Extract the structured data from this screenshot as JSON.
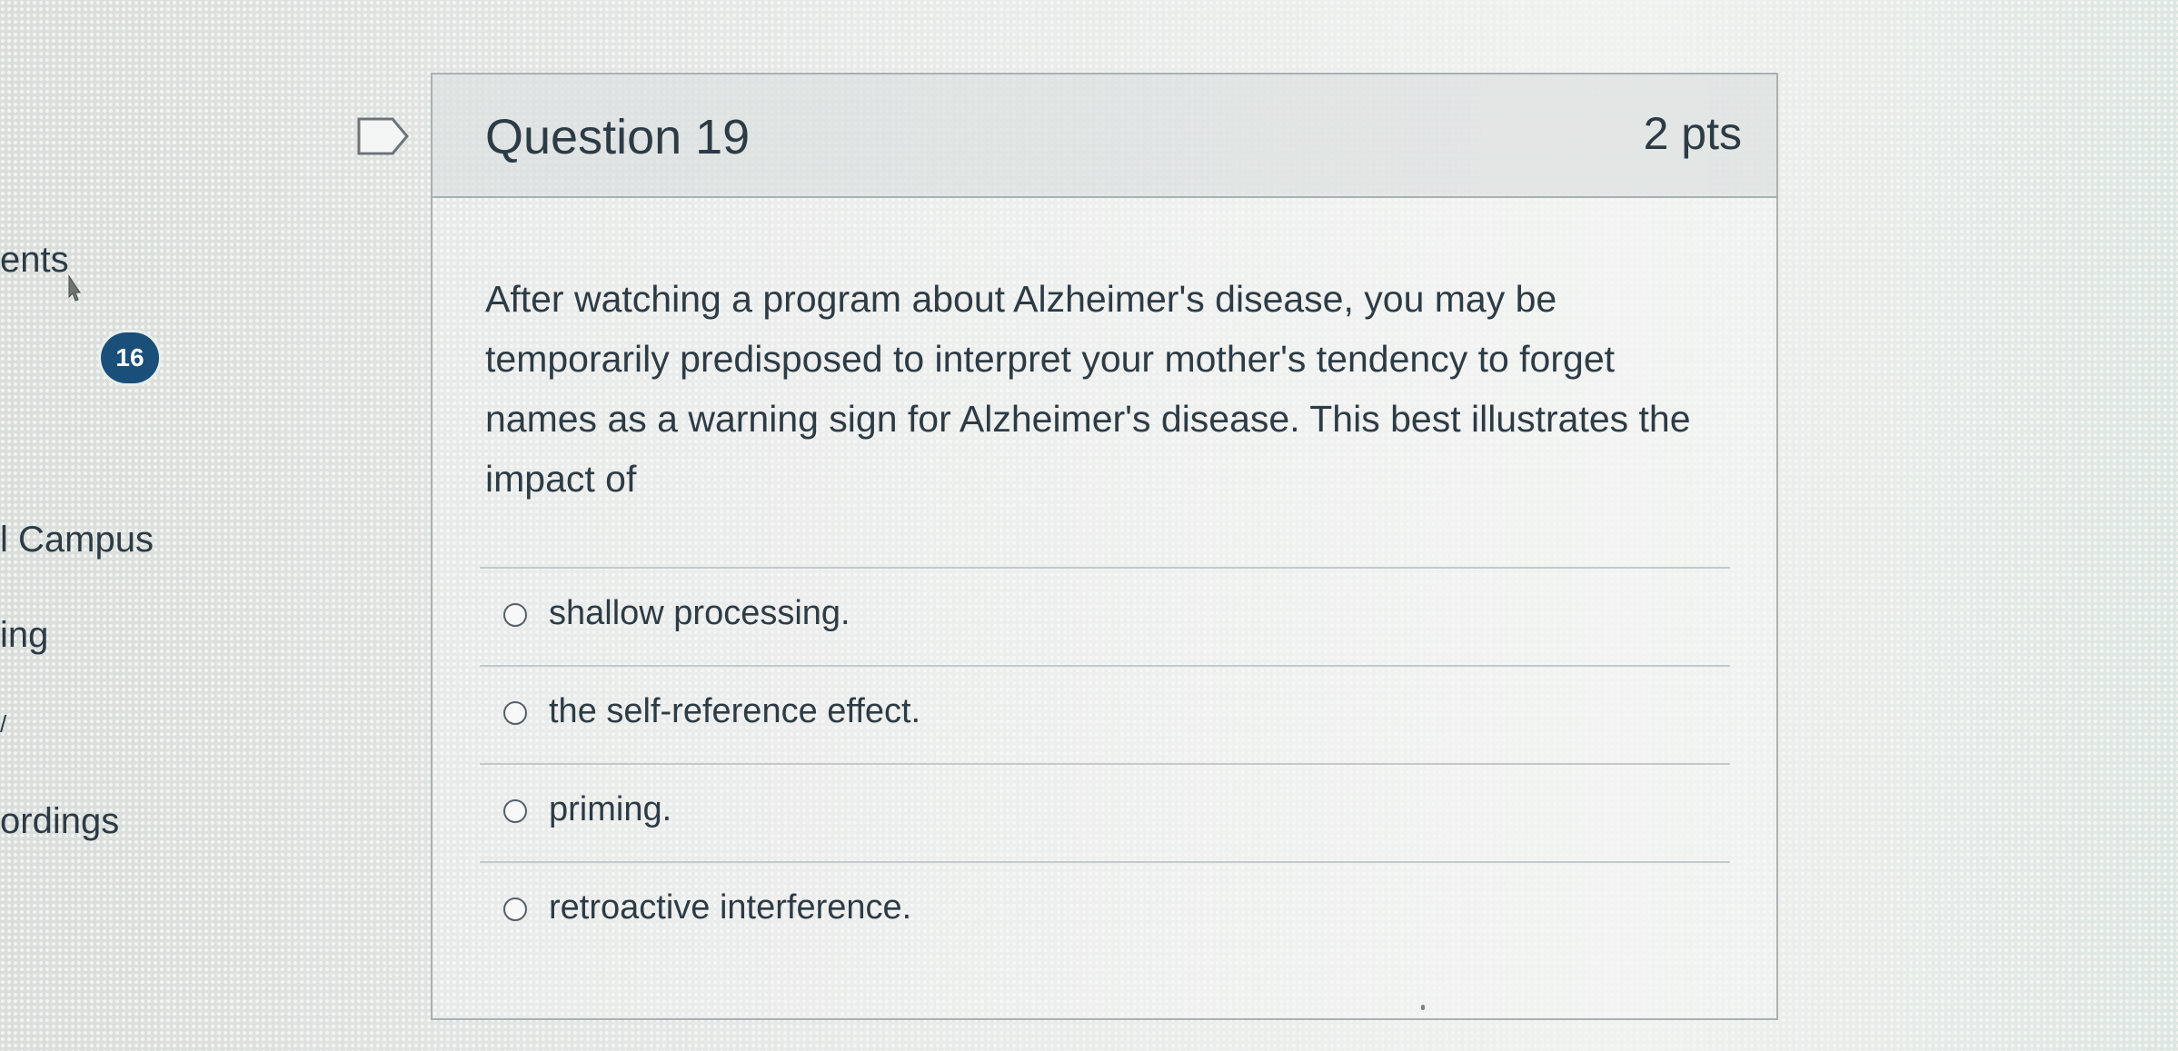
{
  "sidebar": {
    "items": [
      "ents",
      "l Campus",
      "ing",
      "/",
      "ordings"
    ],
    "badge_count": "16"
  },
  "question": {
    "title": "Question 19",
    "points": "2 pts",
    "text": "After watching a program about Alzheimer's disease, you may be temporarily predisposed to interpret your mother's tendency to forget names as a warning sign for Alzheimer's disease. This best illustrates the impact of",
    "answers": [
      {
        "label": "shallow processing.",
        "selected": false
      },
      {
        "label": "the self-reference effect.",
        "selected": false
      },
      {
        "label": "priming.",
        "selected": false
      },
      {
        "label": "retroactive interference.",
        "selected": false
      }
    ]
  },
  "colors": {
    "text": "#2d3b45",
    "badge": "#1a4f7a",
    "border": "#a9b0b2"
  }
}
